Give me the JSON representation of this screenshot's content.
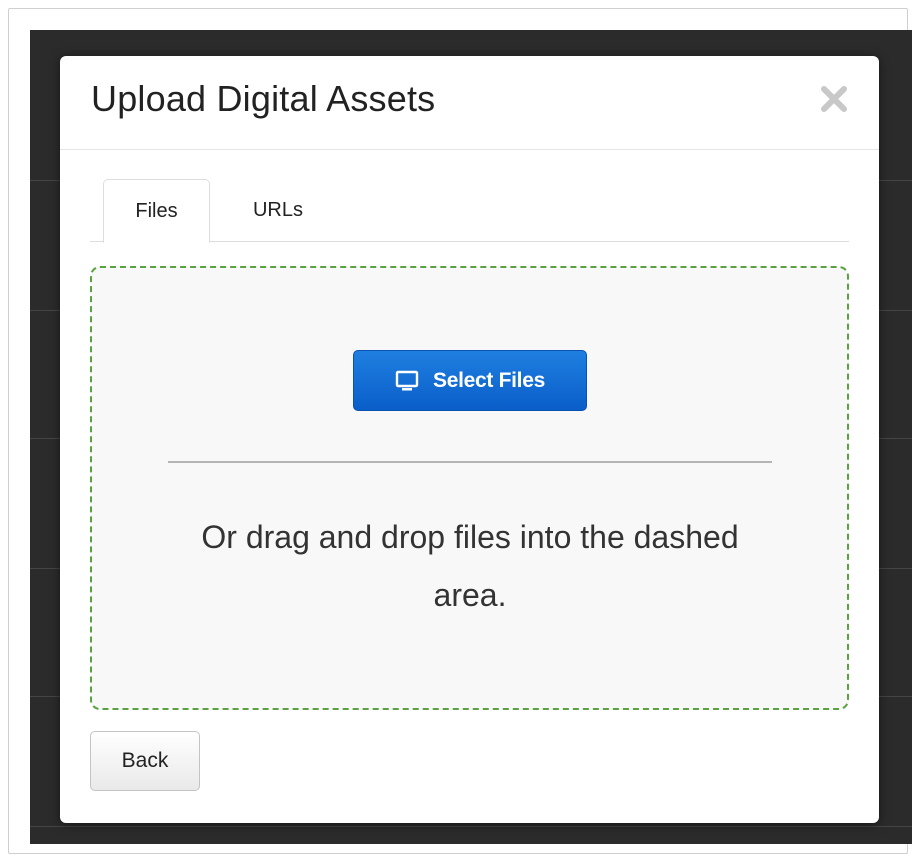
{
  "modal": {
    "title": "Upload Digital Assets",
    "close_icon": "close-icon"
  },
  "tabs": [
    {
      "label": "Files",
      "active": true
    },
    {
      "label": "URLs",
      "active": false
    }
  ],
  "dropzone": {
    "select_button_label": "Select Files",
    "select_button_icon": "monitor-icon",
    "drop_text": "Or drag and drop files into the dashed area.",
    "border_color": "#5aa142"
  },
  "footer": {
    "back_label": "Back"
  },
  "colors": {
    "primary_button": "#0a5ec9",
    "backdrop": "#2b2b2b"
  }
}
